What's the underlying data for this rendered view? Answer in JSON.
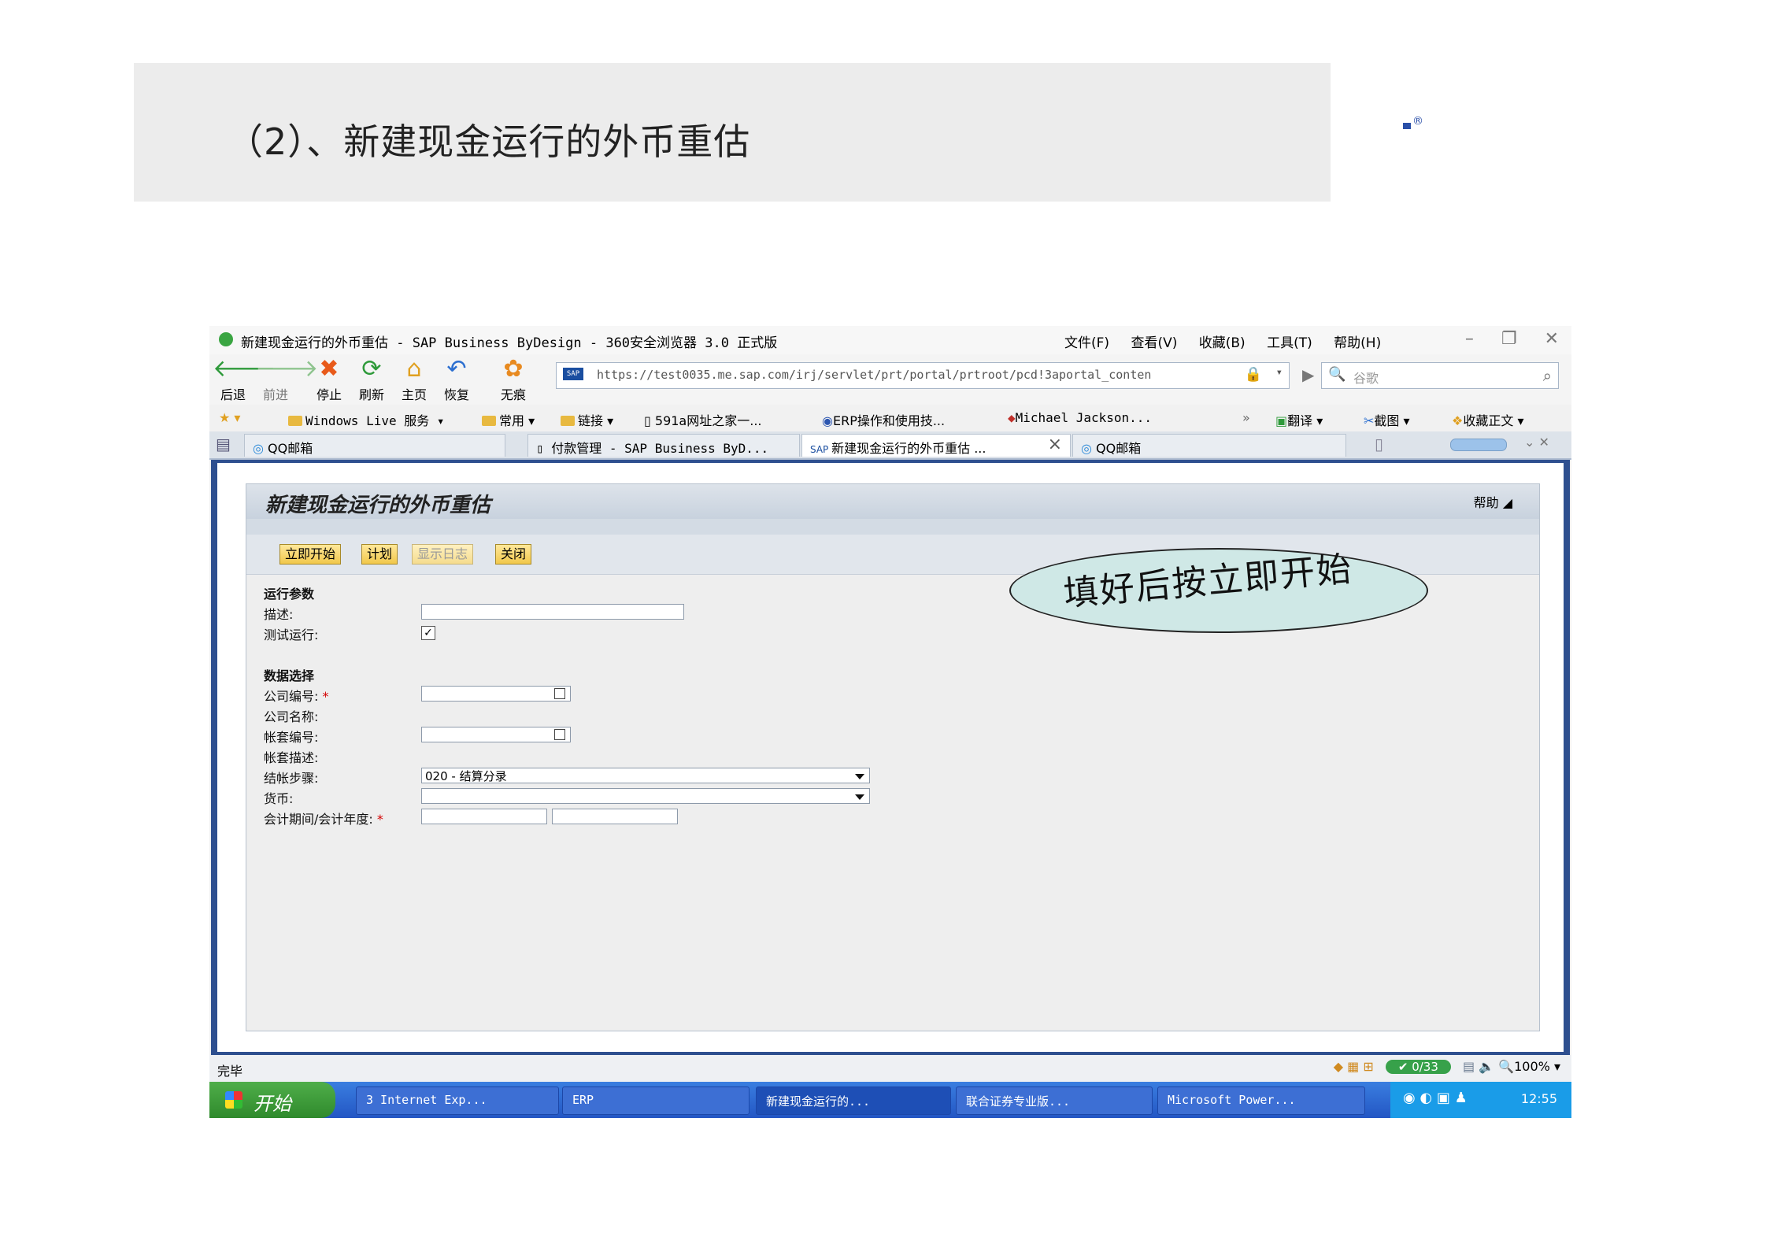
{
  "slide": {
    "title": "（2）、新建现金运行的外币重估",
    "reg_mark": "®"
  },
  "window": {
    "title": "新建现金运行的外币重估 - SAP Business ByDesign - 360安全浏览器 3.0 正式版",
    "menus": [
      "文件(F)",
      "查看(V)",
      "收藏(B)",
      "工具(T)",
      "帮助(H)"
    ],
    "controls": [
      "–",
      "❐",
      "✕"
    ]
  },
  "toolbar": {
    "back": "后退",
    "forward": "前进",
    "stop": "停止",
    "refresh": "刷新",
    "home": "主页",
    "restore": "恢复",
    "noTrace": "无痕",
    "url": "https://test0035.me.sap.com/irj/servlet/prt/portal/prtroot/pcd!3aportal_conten",
    "search_placeholder": "谷歌"
  },
  "favorites": [
    "Windows Live 服务",
    "常用",
    "链接",
    "591a网址之家一...",
    "ERP操作和使用技...",
    "Michael Jackson...",
    "»",
    "翻译",
    "截图",
    "收藏正文"
  ],
  "tabs": [
    {
      "label": "QQ邮箱"
    },
    {
      "label": "付款管理 - SAP Business ByD..."
    },
    {
      "label": "新建现金运行的外币重估 ..."
    },
    {
      "label": "QQ邮箱"
    }
  ],
  "form": {
    "title": "新建现金运行的外币重估",
    "help": "帮助",
    "buttons": {
      "start_now": "立即开始",
      "schedule": "计划",
      "show_log": "显示日志",
      "close": "关闭"
    },
    "sections": {
      "run_params": "运行参数",
      "data_selection": "数据选择"
    },
    "labels": {
      "description": "描述:",
      "test_run": "测试运行:",
      "company_id": "公司编号:",
      "company_name": "公司名称:",
      "set_id": "帐套编号:",
      "set_desc": "帐套描述:",
      "closing_step": "结帐步骤:",
      "currency": "货币:",
      "period_year": "会计期间/会计年度:"
    },
    "required_mark": "*",
    "checkmark": "✓",
    "test_run_checked": true,
    "closing_step_value": "020 - 结算分录"
  },
  "callout": {
    "text": "填好后按立即开始"
  },
  "status": {
    "text": "完毕",
    "counter": "0/33",
    "zoom": "100%"
  },
  "taskbar": {
    "start": "开始",
    "tasks": [
      "3 Internet Exp...",
      "ERP",
      "新建现金运行的...",
      "联合证券专业版...",
      "Microsoft Power..."
    ],
    "clock": "12:55"
  }
}
